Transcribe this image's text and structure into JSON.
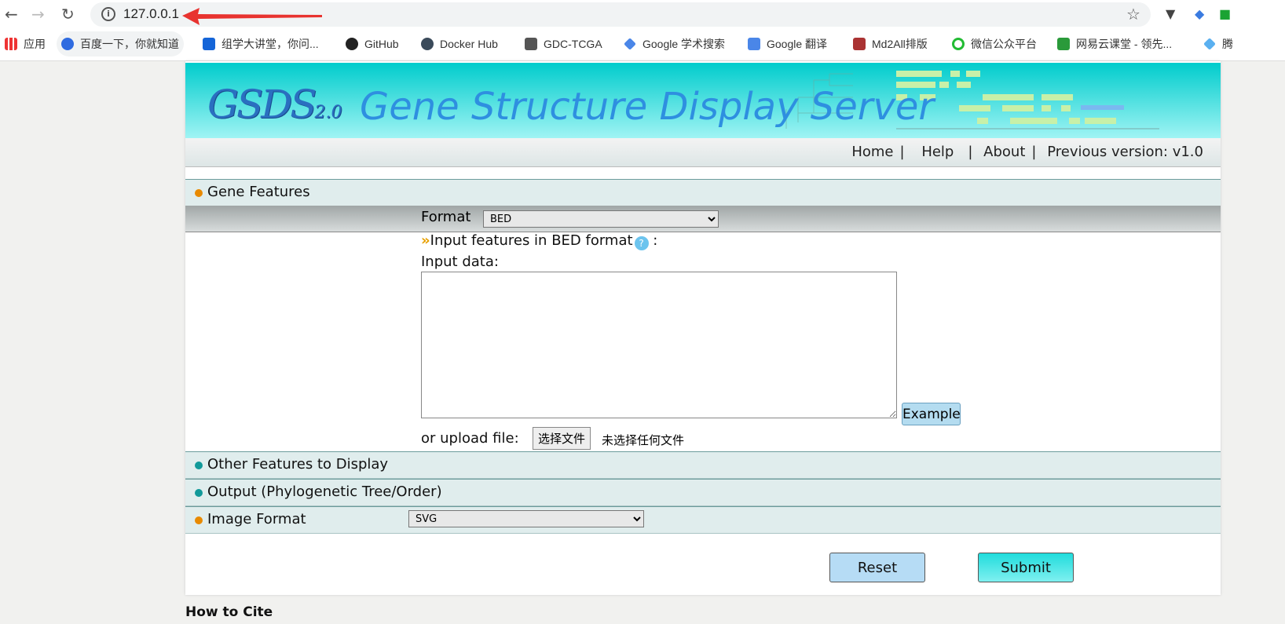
{
  "browser": {
    "url": "127.0.0.1",
    "bookmarks": [
      {
        "label": "应用",
        "icon": "apps-grid-icon"
      },
      {
        "label": "百度一下，你就知道",
        "icon": "baidu-icon"
      },
      {
        "label": "组学大讲堂，你问...",
        "icon": "omics-icon"
      },
      {
        "label": "GitHub",
        "icon": "github-icon"
      },
      {
        "label": "Docker Hub",
        "icon": "docker-icon"
      },
      {
        "label": "GDC-TCGA",
        "icon": "gdc-icon"
      },
      {
        "label": "Google 学术搜索",
        "icon": "scholar-icon"
      },
      {
        "label": "Google 翻译",
        "icon": "translate-icon"
      },
      {
        "label": "Md2All排版",
        "icon": "md2all-icon"
      },
      {
        "label": "微信公众平台",
        "icon": "wechat-icon"
      },
      {
        "label": "网易云课堂 - 领先...",
        "icon": "netease-icon"
      },
      {
        "label": "腾",
        "icon": "tencent-icon"
      }
    ]
  },
  "header": {
    "logo": "GSDS",
    "logo_version": "2.0",
    "title": "Gene Structure Display Server"
  },
  "nav": {
    "home": "Home",
    "help": "Help",
    "about": "About",
    "previous": "Previous version: v1.0"
  },
  "sections": {
    "gene_features": "Gene Features",
    "other_features": "Other Features to Display",
    "output": "Output (Phylogenetic Tree/Order)",
    "image_format": "Image Format"
  },
  "form": {
    "format_label": "Format",
    "format_value": "BED",
    "hint": "Input features in BED format",
    "hint_colon": ":",
    "input_label": "Input data:",
    "input_value": "",
    "example": "Example",
    "upload_label": "or upload file:",
    "file_button": "选择文件",
    "file_status": "未选择任何文件",
    "image_format_value": "SVG",
    "reset": "Reset",
    "submit": "Submit"
  },
  "cutoff_text": "How to Cite",
  "colors": {
    "banner": "#00cccc",
    "section_bg": "#e0eded",
    "dot_active": "#e88a00",
    "dot_inactive": "#119999",
    "submit": "#20dcdc",
    "reset": "#b6dcf5"
  }
}
